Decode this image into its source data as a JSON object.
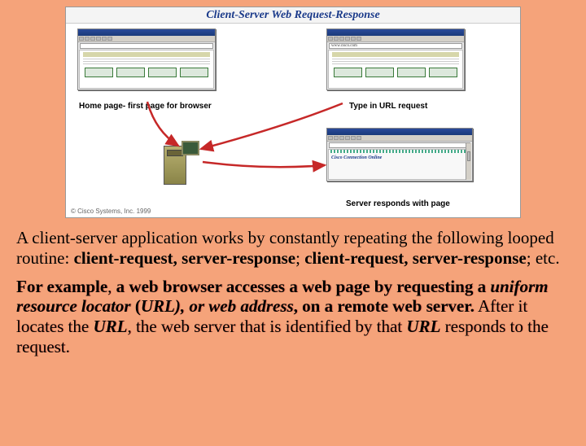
{
  "diagram": {
    "title": "Client-Server Web Request-Response",
    "browser_b_url": "www.cisco.com",
    "cco_text": "Cisco Connection Online",
    "caption_a": "Home page- first page for browser",
    "caption_b": "Type in URL request",
    "caption_c": "Server responds with page",
    "copyright": "© Cisco Systems, Inc. 1999"
  },
  "para1": {
    "t1": "A client-server application works by constantly repeating the following looped routine: ",
    "b1": "client-request, server-response",
    "t2": "; ",
    "b2": "client-request, server-response",
    "t3": "; etc."
  },
  "para2": {
    "t1": "For example",
    "t2": ", ",
    "b1": "a web browser accesses a web page by requesting a ",
    "bi1": "uniform resource locator",
    "b2": " (",
    "bi2": "URL",
    "b3": "), ",
    "bi3": "or web address",
    "b4": ", on a remote web server.",
    "t3": " After it locates the ",
    "bi4": "URL",
    "t4": ", the web server that is identified by that ",
    "bi5": "URL",
    "t5": " responds to the request."
  }
}
